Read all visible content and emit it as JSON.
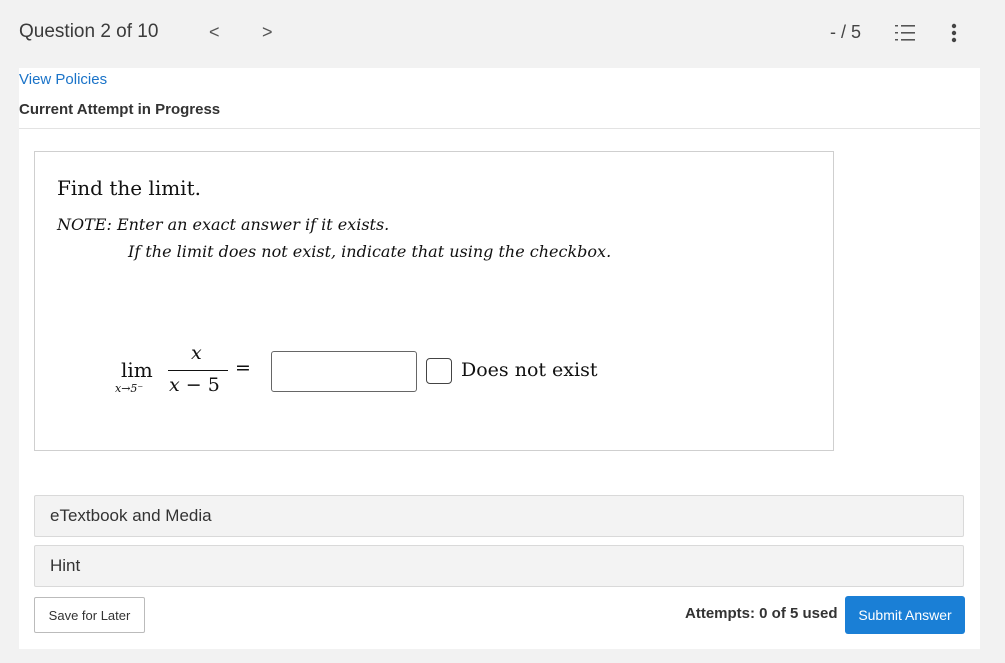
{
  "header": {
    "question_progress": "Question 2 of 10",
    "prev_label": "<",
    "next_label": ">",
    "score": "- / 5"
  },
  "links": {
    "view_policies": "View Policies"
  },
  "status": {
    "attempt_status": "Current Attempt in Progress"
  },
  "question": {
    "heading": "Find the limit.",
    "note_line1": "NOTE: Enter an exact answer if it exists.",
    "note_line2": "If the limit does not exist, indicate that using the checkbox.",
    "limit_word": "lim",
    "limit_subscript": "x→5⁻",
    "numerator": "x",
    "denominator_var": "x",
    "denominator_rest": " − 5",
    "equals": "=",
    "answer_value": "",
    "dne_label": "Does not exist",
    "dne_checked": false
  },
  "sections": {
    "media_label": "eTextbook and Media",
    "hint_label": "Hint"
  },
  "footer": {
    "save_label": "Save for Later",
    "attempts": "Attempts: 0 of 5 used",
    "submit_label": "Submit Answer"
  },
  "icons": {
    "list": "numbered-list-icon",
    "more": "vertical-ellipsis-icon",
    "prev": "chevron-left-icon",
    "next": "chevron-right-icon"
  },
  "colors": {
    "link": "#1a73c8",
    "submit": "#1a7fd6",
    "background": "#f2f2f2"
  }
}
